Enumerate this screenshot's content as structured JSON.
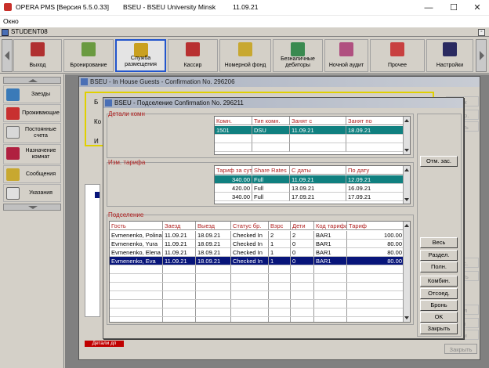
{
  "titlebar": {
    "app": "OPERA PMS [Версия 5.5.0.33]",
    "property": "BSEU - BSEU University Minsk",
    "date": "11.09.21",
    "minimize": "—",
    "maximize": "☐",
    "close": "✕"
  },
  "menu": {
    "window": "Окно"
  },
  "mdi": {
    "title": "STUDENT08",
    "restore": "▫"
  },
  "toolbar": {
    "buttons": [
      {
        "label": "Выход"
      },
      {
        "label": "Бронирование"
      },
      {
        "label": "Служба размещения"
      },
      {
        "label": "Кассир"
      },
      {
        "label": "Номерной фонд"
      },
      {
        "label": "Безналичные дебиторы"
      },
      {
        "label": "Ночной аудит"
      },
      {
        "label": "Прочее"
      },
      {
        "label": "Настройки"
      }
    ]
  },
  "nav": {
    "items": [
      {
        "label": "Заезды"
      },
      {
        "label": "Проживающие"
      },
      {
        "label": "Постоянные счета"
      },
      {
        "label": "Назначение комнат"
      },
      {
        "label": "Сообщения"
      },
      {
        "label": "Указания"
      }
    ]
  },
  "bg_window": {
    "title": "BSEU - In House Guests - Confirmation No.  296206",
    "frag_ko": "Ко",
    "frag_i": "И",
    "frag_b": "Б",
    "right_buttons": [
      "иск",
      "фир.",
      "нить",
      "рас.",
      "нить",
      "айл",
      "ии",
      "ати"
    ],
    "red_tab": "Детали дп",
    "close": "Закрыть"
  },
  "dialog": {
    "title": "BSEU - Подселение  Confirmation No.  296211",
    "rooms": {
      "label": "Детали комн",
      "headers": [
        "Комн.",
        "Тип комн.",
        "Занят с",
        "Занят по"
      ],
      "rows": [
        [
          "1501",
          "DSU",
          "11.09.21",
          "18.09.21"
        ]
      ]
    },
    "rates": {
      "label": "Изм. тарифа",
      "headers": [
        "Тариф за сутки",
        "Share Rates",
        "С даты",
        "По дату"
      ],
      "rows": [
        [
          "340.00",
          "Full",
          "11.09.21",
          "12.09.21"
        ],
        [
          "420.00",
          "Full",
          "13.09.21",
          "16.09.21"
        ],
        [
          "340.00",
          "Full",
          "17.09.21",
          "17.09.21"
        ]
      ]
    },
    "sharers": {
      "label": "Подселение",
      "headers": [
        "Гость",
        "Заезд",
        "Выезд",
        "Статус бр.",
        "Взрс",
        "Дети",
        "Код тарифа",
        "Тариф"
      ],
      "rows": [
        [
          "Evmenenko, Polina",
          "11.09.21",
          "18.09.21",
          "Checked In",
          "2",
          "2",
          "BAR1",
          "100.00"
        ],
        [
          "Evmenenko, Yura",
          "11.09.21",
          "18.09.21",
          "Checked In",
          "1",
          "0",
          "BAR1",
          "80.00"
        ],
        [
          "Evmenenko, Elena",
          "11.09.21",
          "18.09.21",
          "Checked In",
          "1",
          "0",
          "BAR1",
          "80.00"
        ],
        [
          "Evmenenko, Eva",
          "11.09.21",
          "18.09.21",
          "Checked In",
          "1",
          "0",
          "BAR1",
          "80.00"
        ]
      ]
    },
    "buttons": {
      "cancel_share": "Отм. зас.",
      "all": "Весь",
      "split": "Раздел.",
      "full": "Полн.",
      "combine": "Комбин.",
      "detach": "Отсоед.",
      "reservation": "Бронь",
      "ok": "OK",
      "close": "Закрыть"
    }
  },
  "colors": {
    "teal": "#108080",
    "navy": "#08157a",
    "header_red": "#b02020"
  }
}
